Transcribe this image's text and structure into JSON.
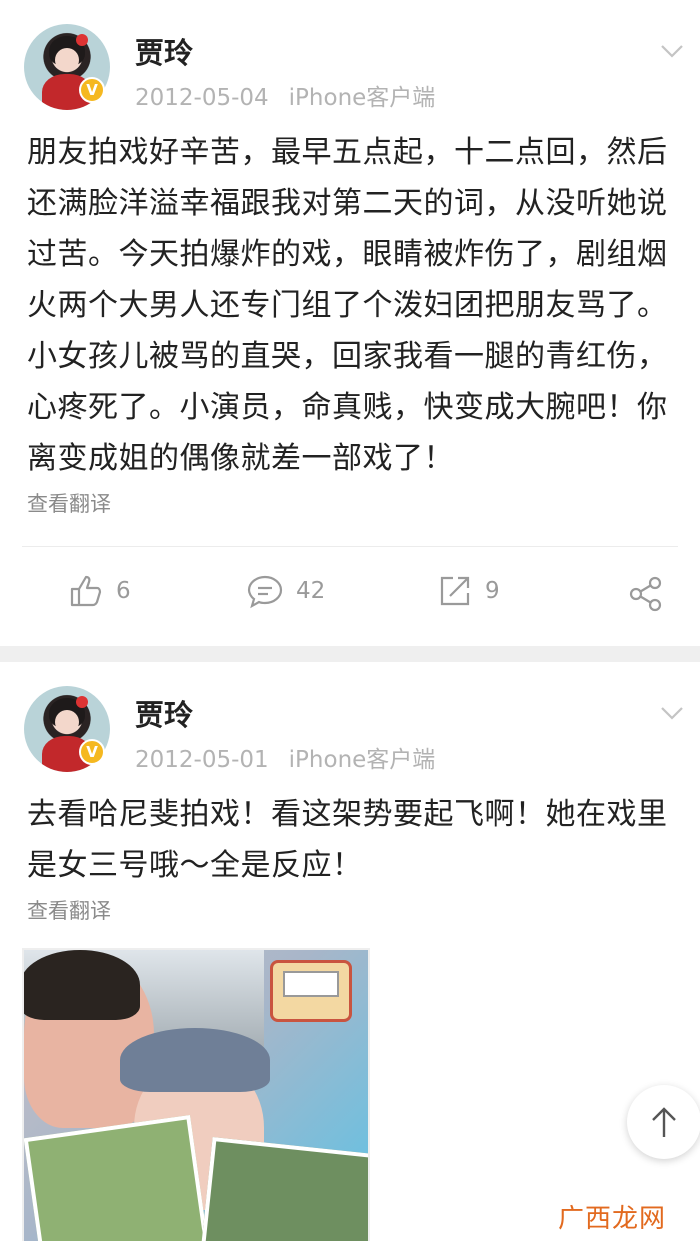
{
  "posts": [
    {
      "author": "贾玲",
      "date": "2012-05-04",
      "client": "iPhone客户端",
      "text": "朋友拍戏好辛苦，最早五点起，十二点回，然后还满脸洋溢幸福跟我对第二天的词，从没听她说过苦。今天拍爆炸的戏，眼睛被炸伤了，剧组烟火两个大男人还专门组了个泼妇团把朋友骂了。小女孩儿被骂的直哭，回家我看一腿的青红伤，心疼死了。小演员，命真贱，快变成大腕吧！你离变成姐的偶像就差一部戏了！",
      "translate_label": "查看翻译",
      "likes": "6",
      "comments": "42",
      "reposts": "9",
      "badge": "V"
    },
    {
      "author": "贾玲",
      "date": "2012-05-01",
      "client": "iPhone客户端",
      "text": "去看哈尼斐拍戏！看这架势要起飞啊！她在戏里是女三号哦～全是反应！",
      "translate_label": "查看翻译",
      "badge": "V"
    }
  ],
  "watermark": "广西龙网",
  "colors": {
    "badge": "#f5b820",
    "meta_text": "#b3b3b3",
    "separator": "#efefef",
    "watermark": "#e26a1f"
  },
  "icons": [
    "chevron-down-icon",
    "like-icon",
    "comment-icon",
    "repost-icon",
    "share-icon",
    "arrow-up-icon"
  ]
}
